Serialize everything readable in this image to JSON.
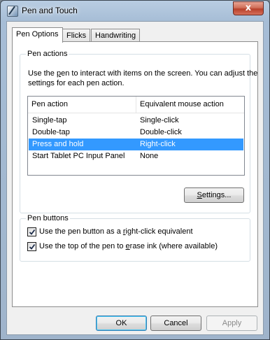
{
  "window": {
    "title": "Pen and Touch",
    "close_glyph": "x"
  },
  "tabs": [
    {
      "label": "Pen Options",
      "active": true
    },
    {
      "label": "Flicks",
      "active": false
    },
    {
      "label": "Handwriting",
      "active": false
    }
  ],
  "pen_actions": {
    "group_label": "Pen actions",
    "desc_1": "Use the ",
    "desc_key": "p",
    "desc_2": "en to interact with items on the screen.  You can adjust the settings for each pen action.",
    "columns": [
      "Pen action",
      "Equivalent mouse action"
    ],
    "rows": [
      {
        "action": "Single-tap",
        "mouse": "Single-click",
        "selected": false
      },
      {
        "action": "Double-tap",
        "mouse": "Double-click",
        "selected": false
      },
      {
        "action": "Press and hold",
        "mouse": "Right-click",
        "selected": true
      },
      {
        "action": "Start Tablet PC Input Panel",
        "mouse": "None",
        "selected": false
      }
    ],
    "settings_key": "S",
    "settings_rest": "ettings..."
  },
  "pen_buttons": {
    "group_label": "Pen buttons",
    "options": [
      {
        "label_1": "Use the pen button as a ",
        "key": "r",
        "label_2": "ight-click equivalent",
        "checked": true
      },
      {
        "label_1": "Use the top of the pen to ",
        "key": "e",
        "label_2": "rase ink (where available)",
        "checked": true
      }
    ]
  },
  "footer": {
    "ok": "OK",
    "cancel": "Cancel",
    "apply": "Apply"
  },
  "colors": {
    "selection": "#3399ff",
    "close_button": "#c7452f",
    "group_border": "#d5dfe5"
  }
}
